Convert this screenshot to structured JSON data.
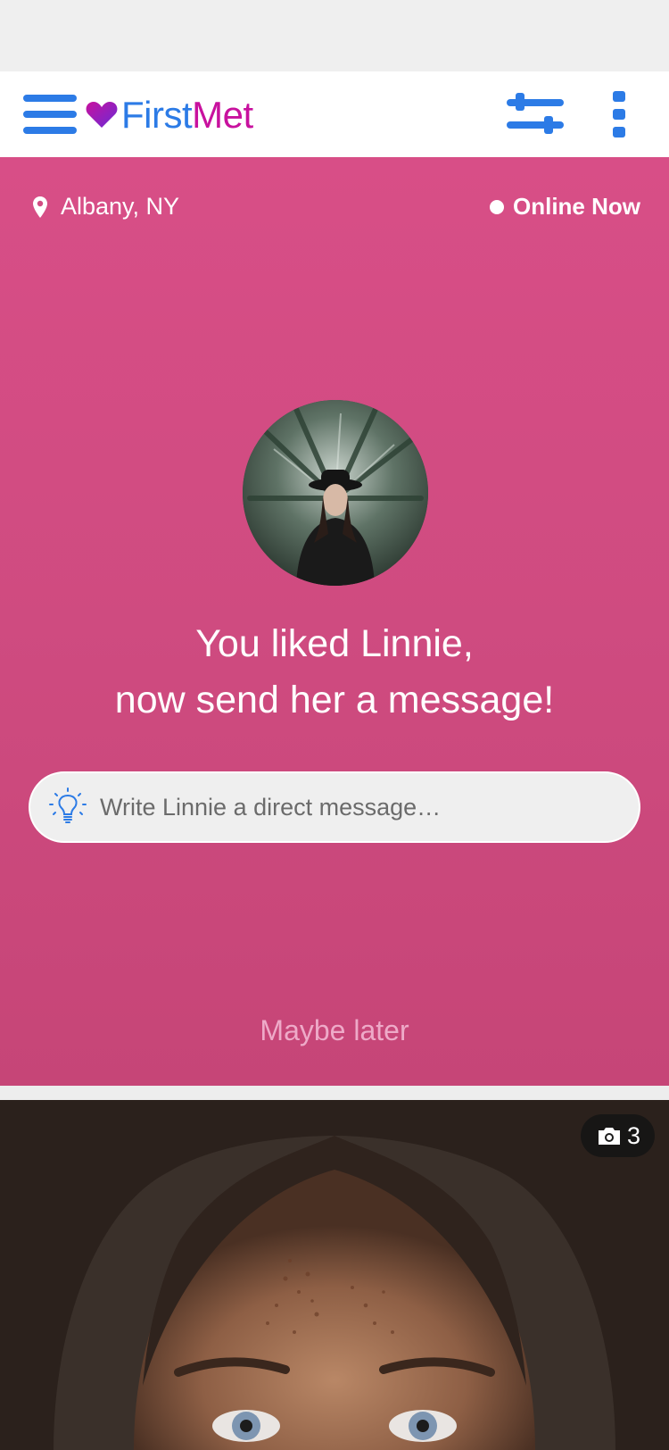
{
  "app": {
    "name_part1": "First",
    "name_part2": "Met",
    "brand_blue": "#2c7be6",
    "brand_magenta": "#c8119e"
  },
  "header": {
    "icons": [
      "hamburger-menu-icon",
      "heart-logo-icon",
      "filter-sliders-icon",
      "more-vertical-icon"
    ]
  },
  "profile": {
    "location": "Albany, NY",
    "status": "Online Now",
    "headline_line1": "You liked Linnie,",
    "headline_line2": "now send her a message!",
    "message_placeholder": "Write Linnie a direct message…",
    "dismiss_label": "Maybe later",
    "panel_color": "#d24c83"
  },
  "photo_card": {
    "photo_count": "3"
  }
}
